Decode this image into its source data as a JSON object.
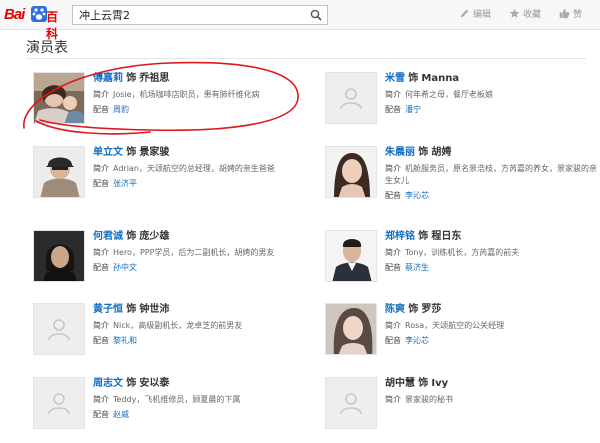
{
  "header": {
    "logo_text": "Bai",
    "logo_suffix": "百科",
    "search_value": "冲上云霄2",
    "actions": [
      {
        "label": "编辑",
        "icon": "edit-icon"
      },
      {
        "label": "收藏",
        "icon": "star-icon"
      },
      {
        "label": "赞",
        "icon": "thumbs-up-icon"
      }
    ]
  },
  "section": {
    "title": "演员表"
  },
  "labels": {
    "shi": "饰",
    "intro": "简介",
    "dub": "配音"
  },
  "cast": [
    {
      "actor": "傅嘉莉",
      "role": "乔祖思",
      "intro": "Josie，机场咖啡店职员，患有肺纤维化病",
      "dub": "周豹",
      "photo": "woman-with-child-photo"
    },
    {
      "actor": "米雪",
      "role": "Manna",
      "intro": "何年希之母，餐厅老板娘",
      "dub": "潘宁",
      "photo": "placeholder"
    },
    {
      "actor": "单立文",
      "role": "景家骏",
      "intro": "Adrian，天颂航空的总经理，胡娉的亲生爸爸",
      "dub": "张济平",
      "photo": "man-cap-photo"
    },
    {
      "actor": "朱晨丽",
      "role": "胡娉",
      "intro": "机舱服务员，原名景浩枝，方芮嘉的养女，景家骏的亲生女儿",
      "dub": "李沁芯",
      "photo": "woman-smiling-photo"
    },
    {
      "actor": "何君诚",
      "role": "庞少雄",
      "intro": "Hero，PPP学员，后为二副机长，胡娉的男友",
      "dub": "孙中文",
      "photo": "man-long-hair-photo"
    },
    {
      "actor": "郑梓铭",
      "role": "程日东",
      "intro": "Tony，训练机长，方芮嘉的前夫",
      "dub": "蔡济生",
      "photo": "man-suit-photo"
    },
    {
      "actor": "黄子恒",
      "role": "钟世沛",
      "intro": "Nick，高级副机长，龙卓芝的前男友",
      "dub": "黎礼和",
      "photo": "placeholder"
    },
    {
      "actor": "陈爽",
      "role": "罗莎",
      "intro": "Rosa，天颂航空的公关经理",
      "dub": "李沁芯",
      "photo": "woman-long-hair-photo"
    },
    {
      "actor": "周志文",
      "role": "安以泰",
      "intro": "Teddy，飞机维修员，顾夏晨的下属",
      "dub": "赵威",
      "photo": "placeholder"
    },
    {
      "actor": "胡中慧",
      "role": "Ivy",
      "intro": "景家骏的秘书",
      "dub": "",
      "photo": "placeholder"
    }
  ]
}
